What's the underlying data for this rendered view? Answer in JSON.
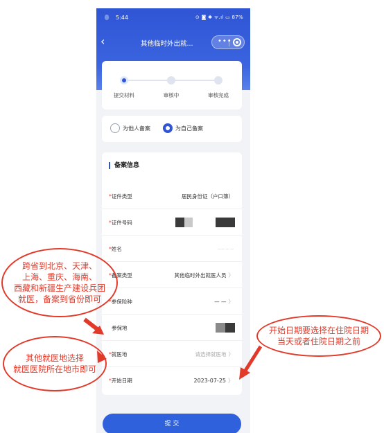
{
  "status": {
    "time": "5:44",
    "indicators": "⊙ ◙ ✱ ᯤ.ıl ▭ 87%"
  },
  "nav": {
    "back_glyph": "‹",
    "title": "其他临时外出就...",
    "more_glyph": "•••"
  },
  "steps": [
    {
      "label": "提交材料",
      "active": true
    },
    {
      "label": "审核中",
      "active": false
    },
    {
      "label": "审核完成",
      "active": false
    }
  ],
  "filing_options": [
    {
      "label": "为他人备案",
      "selected": false
    },
    {
      "label": "为自己备案",
      "selected": true
    }
  ],
  "form": {
    "title": "备案信息",
    "rows": [
      {
        "label": "证件类型",
        "required": true,
        "value": "居民身份证（户口簿）",
        "chevron": ""
      },
      {
        "label": "证件号码",
        "required": true,
        "value": "",
        "chevron": ""
      },
      {
        "label": "姓名",
        "required": true,
        "value": "—— — —",
        "chevron": ""
      },
      {
        "label": "备案类型",
        "required": true,
        "value": "其他临时外出就医人员",
        "chevron": "〉"
      },
      {
        "label": "参保险种",
        "required": true,
        "value": "— —",
        "chevron": "〉"
      },
      {
        "label": "参保地",
        "required": false,
        "value": "",
        "chevron": ""
      },
      {
        "label": "就医地",
        "required": true,
        "value": "请选择就医地",
        "chevron": "〉"
      },
      {
        "label": "开始日期",
        "required": true,
        "value": "2023-07-25",
        "chevron": "〉"
      }
    ]
  },
  "submit_label": "提 交",
  "annotations": {
    "left_top": [
      "跨省到北京、天津、",
      "上海、重庆、海南、",
      "西藏和新疆生产建设兵团",
      "就医，备案到省份即可"
    ],
    "left_bottom": [
      "其他就医地选择",
      "就医医院所在地市即可"
    ],
    "right": [
      "开始日期要选择在住院日期",
      "当天或者住院日期之前"
    ]
  },
  "colors": {
    "primary": "#2f55d4",
    "annotation_red": "#e23a2a",
    "required_red": "#e83b2e"
  }
}
